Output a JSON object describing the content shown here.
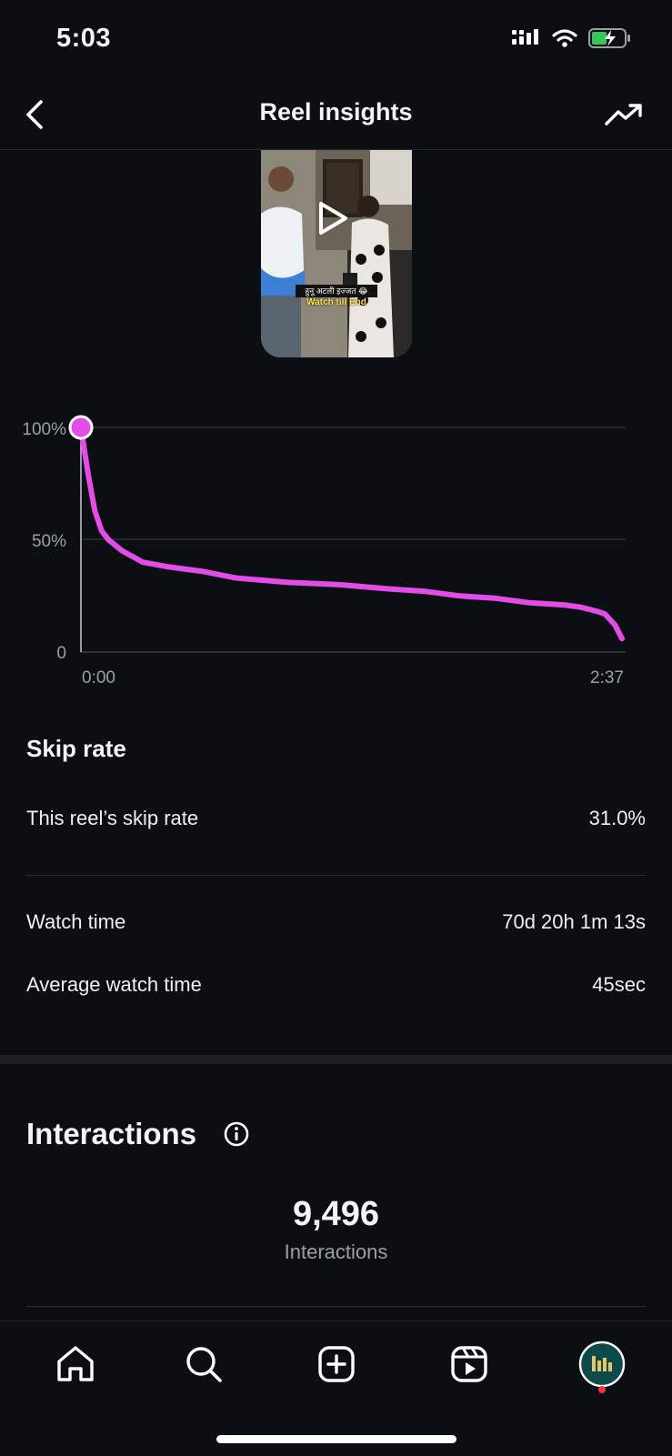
{
  "status_bar": {
    "time": "5:03"
  },
  "header": {
    "title": "Reel insights"
  },
  "reel": {
    "thumbnail_caption_line1": "हुनू अटली इज्जत 😂",
    "thumbnail_caption_line2": "Watch till End"
  },
  "retention_chart": {
    "accent_color": "#e34ce6",
    "y_tick_labels": [
      "100%",
      "50%",
      "0"
    ],
    "x_tick_labels": [
      "0:00",
      "2:37"
    ]
  },
  "chart_data": {
    "type": "line",
    "xlabel": "",
    "ylabel": "",
    "x_range_seconds": [
      0,
      157
    ],
    "ylim": [
      0,
      100
    ],
    "series": [
      {
        "x": [
          0,
          2,
          4,
          6,
          8,
          12,
          18,
          25,
          35,
          45,
          60,
          75,
          90,
          100,
          110,
          120,
          130,
          140,
          145,
          150,
          152,
          155,
          157
        ],
        "values": [
          100,
          80,
          63,
          54,
          50,
          45,
          40,
          38,
          36,
          33,
          31,
          30,
          28,
          27,
          25,
          24,
          22,
          21,
          20,
          18,
          17,
          12,
          6
        ]
      }
    ]
  },
  "skip_rate": {
    "title": "Skip rate",
    "reel_skip_rate_label": "This reel’s skip rate",
    "reel_skip_rate_value": "31.0%",
    "watch_time_label": "Watch time",
    "watch_time_value": "70d 20h 1m 13s",
    "average_watch_time_label": "Average watch time",
    "average_watch_time_value": "45sec"
  },
  "interactions": {
    "title": "Interactions",
    "total_value": "9,496",
    "total_caption": "Interactions"
  },
  "bottom_nav": {
    "items": [
      "home-icon",
      "search-icon",
      "create-icon",
      "reels-icon",
      "profile-avatar"
    ],
    "notification_dot_color": "#ff3040"
  }
}
